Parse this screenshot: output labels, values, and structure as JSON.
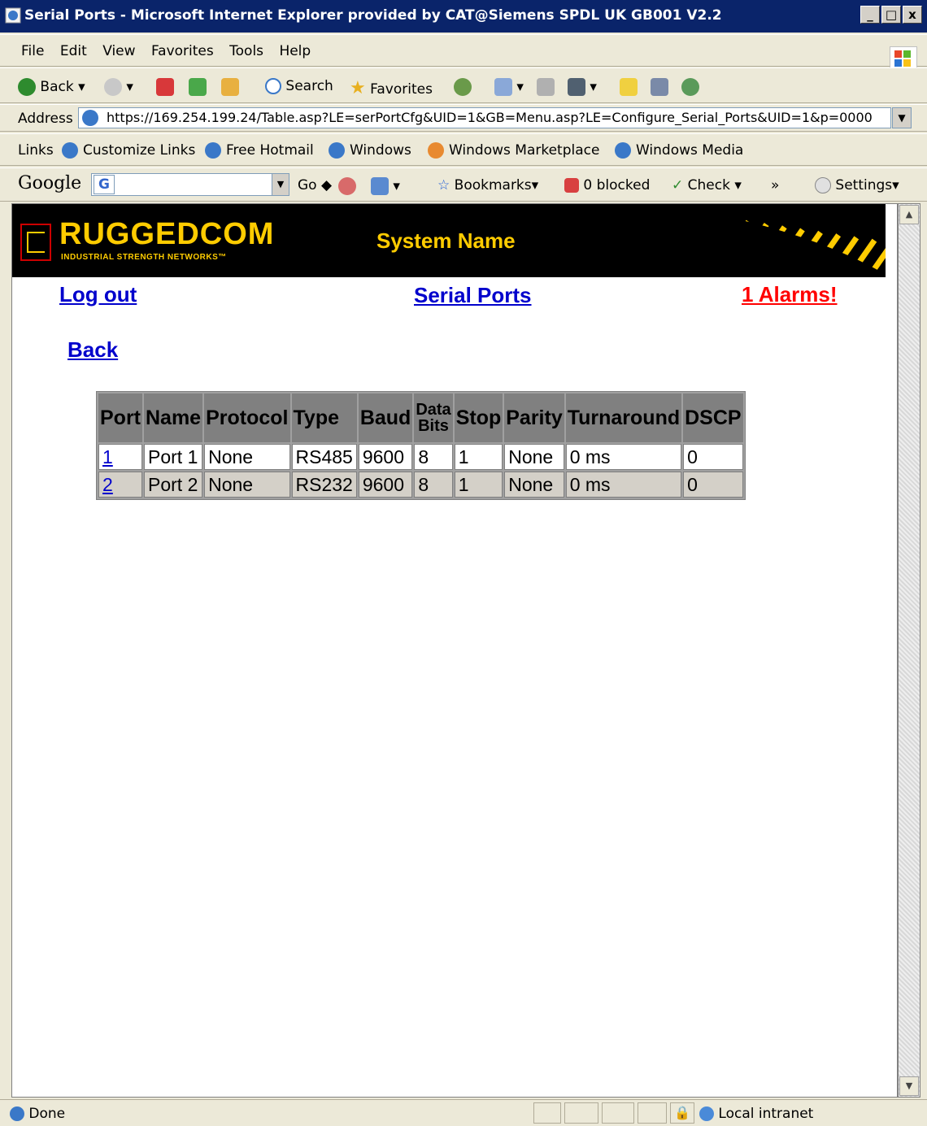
{
  "window": {
    "title": "Serial Ports - Microsoft Internet Explorer provided by CAT@Siemens SPDL UK GB001 V2.2",
    "min": "_",
    "max": "□",
    "close": "x"
  },
  "menu": [
    "File",
    "Edit",
    "View",
    "Favorites",
    "Tools",
    "Help"
  ],
  "toolbar": {
    "back": "Back",
    "search": "Search",
    "favorites": "Favorites"
  },
  "address": {
    "label": "Address",
    "url": "https://169.254.199.24/Table.asp?LE=serPortCfg&UID=1&GB=Menu.asp?LE=Configure_Serial_Ports&UID=1&p=0000"
  },
  "links": {
    "label": "Links",
    "items": [
      "Customize Links",
      "Free Hotmail",
      "Windows",
      "Windows Marketplace",
      "Windows Media"
    ]
  },
  "google": {
    "logo": "Google",
    "g": "G",
    "go": "Go",
    "bookmarks": "Bookmarks",
    "blocked": "0 blocked",
    "check": "Check",
    "more": "»",
    "settings": "Settings"
  },
  "banner": {
    "logo": "RUGGEDCOM",
    "tagline": "INDUSTRIAL STRENGTH NETWORKS™",
    "system_name": "System Name"
  },
  "nav": {
    "logout": "Log out",
    "title": "Serial Ports",
    "alarms": "1 Alarms!",
    "back": "Back"
  },
  "table": {
    "headers": [
      "Port",
      "Name",
      "Protocol",
      "Type",
      "Baud",
      "Data",
      "Bits",
      "Stop",
      "Parity",
      "Turnaround",
      "DSCP"
    ],
    "rows": [
      [
        "1",
        "Port 1",
        "None",
        "RS485",
        "9600",
        "8",
        "1",
        "None",
        "0 ms",
        "0"
      ],
      [
        "2",
        "Port 2",
        "None",
        "RS232",
        "9600",
        "8",
        "1",
        "None",
        "0 ms",
        "0"
      ]
    ]
  },
  "status": {
    "done": "Done",
    "zone": "Local intranet"
  },
  "colors": {
    "titlebar": "#0a246a",
    "banner_bg": "#000000",
    "brand": "#ffcc00",
    "link": "#0000cc",
    "alarm": "#ff0000"
  }
}
